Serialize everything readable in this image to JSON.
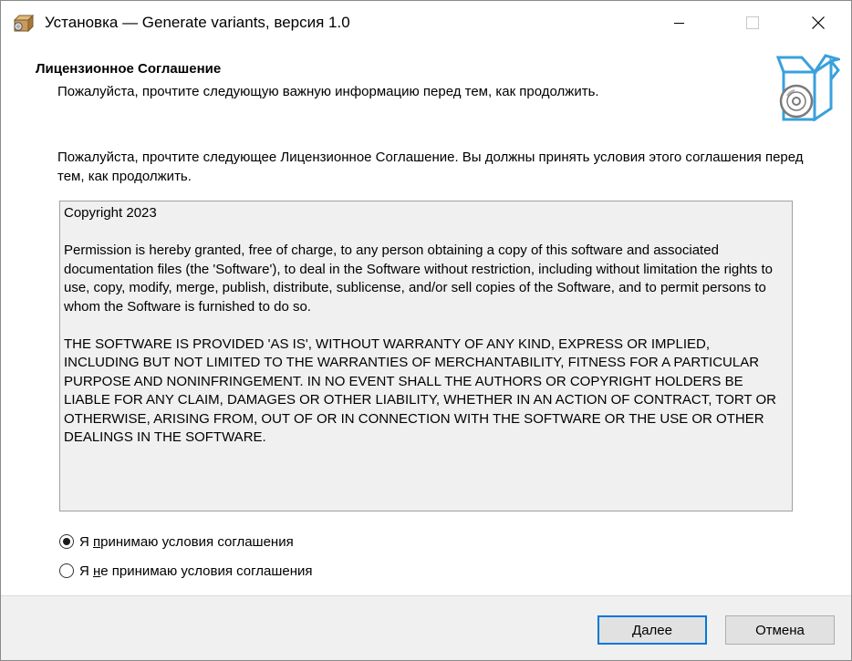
{
  "window": {
    "title": "Установка — Generate variants, версия 1.0",
    "icons": {
      "app": "installer-package-icon",
      "minimize": "minimize-icon",
      "maximize": "maximize-icon",
      "close": "close-icon"
    }
  },
  "header": {
    "title": "Лицензионное Соглашение",
    "subtitle": "Пожалуйста, прочтите следующую важную информацию перед тем, как продолжить.",
    "image": "box-with-disc-icon"
  },
  "intro": "Пожалуйста, прочтите следующее Лицензионное Соглашение. Вы должны принять условия этого соглашения перед тем, как продолжить.",
  "license_text": "Copyright 2023\n\nPermission is hereby granted, free of charge, to any person obtaining a copy of this software and associated documentation files (the 'Software'), to deal in the Software without restriction, including without limitation the rights to use, copy, modify, merge, publish, distribute, sublicense, and/or sell copies of the Software, and to permit persons to whom the Software is furnished to do so.\n\nTHE SOFTWARE IS PROVIDED 'AS IS', WITHOUT WARRANTY OF ANY KIND, EXPRESS OR IMPLIED, INCLUDING BUT NOT LIMITED TO THE WARRANTIES OF MERCHANTABILITY, FITNESS FOR A PARTICULAR PURPOSE AND NONINFRINGEMENT. IN NO EVENT SHALL THE AUTHORS OR COPYRIGHT HOLDERS BE LIABLE FOR ANY CLAIM, DAMAGES OR OTHER LIABILITY, WHETHER IN AN ACTION OF CONTRACT, TORT OR OTHERWISE, ARISING FROM, OUT OF OR IN CONNECTION WITH THE SOFTWARE OR THE USE OR OTHER DEALINGS IN THE SOFTWARE.",
  "options": {
    "accept": {
      "label_pre": "Я ",
      "label_underlined": "п",
      "label_post": "ринимаю условия соглашения",
      "checked": true
    },
    "decline": {
      "label_pre": "Я ",
      "label_underlined": "н",
      "label_post": "е принимаю условия соглашения",
      "checked": false
    }
  },
  "buttons": {
    "next": {
      "label_underlined": "Д",
      "label_post": "алее"
    },
    "cancel": "Отмена"
  },
  "colors": {
    "accent": "#0078d7",
    "footer_bg": "#f0f0f0",
    "license_bg": "#f0f0f0"
  }
}
